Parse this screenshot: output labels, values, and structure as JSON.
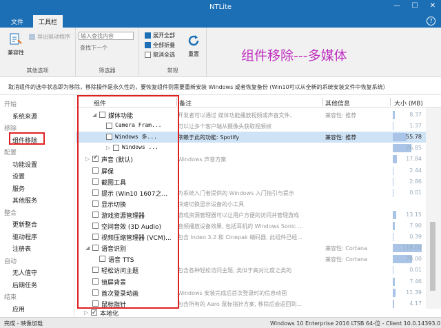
{
  "window": {
    "title": "NTLite"
  },
  "tabs": [
    "文件",
    "工具栏"
  ],
  "ribbon": {
    "compat_label": "兼容性",
    "export_driver_label": "导出驱动程序",
    "other_options_label": "其他选项",
    "search_placeholder": "输入查找内容",
    "find_next_label": "查找下一个",
    "filter_label": "筛选器",
    "expand_all_label": "展开全部",
    "collapse_all_label": "全部折叠",
    "uncheck_all_label": "取消全选",
    "general_label": "常规",
    "reset_label": "重置"
  },
  "overlay_title": "组件移除---多媒体",
  "info_text": "取消组件的选中状态即为移除，移除操作是永久性的，要恢复组件则需要重新安装 Windows 或者恢复备份 (Win10可以从全新的系统安装文件中恢复系统）",
  "sidebar": [
    {
      "kind": "head",
      "label": "开始"
    },
    {
      "kind": "item",
      "label": "系统来源"
    },
    {
      "kind": "head",
      "label": "移除"
    },
    {
      "kind": "item",
      "label": "组件移除"
    },
    {
      "kind": "head",
      "label": "配置"
    },
    {
      "kind": "item",
      "label": "功能设置"
    },
    {
      "kind": "item",
      "label": "设置"
    },
    {
      "kind": "item",
      "label": "服务"
    },
    {
      "kind": "item",
      "label": "其他服务"
    },
    {
      "kind": "head",
      "label": "整合"
    },
    {
      "kind": "item",
      "label": "更新整合"
    },
    {
      "kind": "item",
      "label": "驱动程序"
    },
    {
      "kind": "item",
      "label": "注册表"
    },
    {
      "kind": "head",
      "label": "自动"
    },
    {
      "kind": "item",
      "label": "无人值守"
    },
    {
      "kind": "item",
      "label": "后期任务"
    },
    {
      "kind": "head",
      "label": "结束"
    },
    {
      "kind": "item",
      "label": "应用"
    }
  ],
  "columns": {
    "component": "组件",
    "note": "备注",
    "other": "其他信息",
    "size": "大小 (MB)"
  },
  "rows": [
    {
      "indent": 2,
      "twisty": "expanded",
      "checked": false,
      "name": "媒体功能",
      "note": "开发者可以通过 媒体功能播放视频或声音文件、",
      "other": "兼容性: 推荐",
      "size": "8.37",
      "bar": 0.07
    },
    {
      "indent": 3,
      "twisty": "none",
      "checked": false,
      "name": "Camera Fram...",
      "mono": true,
      "note": "可以让多个客户端从摄像头获取视频帧",
      "other": "",
      "size": "1.37",
      "bar": 0.01
    },
    {
      "indent": 3,
      "twisty": "none",
      "checked": false,
      "name": "Windows 多...",
      "mono": true,
      "note": "依赖于此的功能: Spotify",
      "note_dark": true,
      "other": "兼容性: 推荐",
      "other_dark": true,
      "size": "55.78",
      "size_dark": true,
      "bar": 0.47,
      "highlight": true
    },
    {
      "indent": 4,
      "twisty": "collapsed",
      "checked": false,
      "name": "Windows ...",
      "mono": true,
      "note": "",
      "other": "",
      "size": "76.85",
      "bar": 0.65
    },
    {
      "indent": 1,
      "twisty": "collapsed",
      "checked": true,
      "name": "声音 (默认)",
      "note": "Windows 声音方案",
      "other": "",
      "size": "17.84",
      "bar": 0.15
    },
    {
      "indent": 1,
      "twisty": "none",
      "checked": false,
      "name": "屏保",
      "note": "",
      "other": "",
      "size": "2.44",
      "bar": 0.02
    },
    {
      "indent": 1,
      "twisty": "none",
      "checked": false,
      "name": "截图工具",
      "note": "",
      "other": "",
      "size": "2.86",
      "bar": 0.02
    },
    {
      "indent": 1,
      "twisty": "none",
      "checked": false,
      "name": "提示 (Win10 1607之...",
      "note": "为系统入门者提供的 Windows 入门指引与提示",
      "other": "",
      "size": "0.01",
      "bar": 0.0
    },
    {
      "indent": 1,
      "twisty": "none",
      "checked": false,
      "name": "显示切换",
      "note": "快速切换显示设备的小工具",
      "other": "",
      "size": "",
      "bar": 0.0
    },
    {
      "indent": 1,
      "twisty": "none",
      "checked": false,
      "name": "游戏资源管理器",
      "note": "游戏资源管理器可以让用户方便的访问并管理游戏",
      "other": "",
      "size": "13.15",
      "bar": 0.11
    },
    {
      "indent": 1,
      "twisty": "none",
      "checked": false,
      "name": "空间音效 (3D Audio)",
      "note": "音频播放设备效果, 包括耳机的 Windows Sonic ...",
      "other": "",
      "size": "7.90",
      "bar": 0.07
    },
    {
      "indent": 1,
      "twisty": "none",
      "checked": false,
      "name": "视频压缩管理器 (VCM)...",
      "note": "包含 Indeo 3.2 和 Cinepak 编码器, 此组件已经...",
      "other": "",
      "size": "0.39",
      "bar": 0.0
    },
    {
      "indent": 1,
      "twisty": "expanded",
      "checked": false,
      "name": "语音识别",
      "note": "",
      "other": "兼容性: Cortana",
      "size": "118.00",
      "bar": 1.0
    },
    {
      "indent": 2,
      "twisty": "none",
      "checked": false,
      "name": "语音 TTS",
      "note": "",
      "other": "兼容性: Cortana",
      "size": "78.00",
      "bar": 0.66
    },
    {
      "indent": 1,
      "twisty": "none",
      "checked": false,
      "name": "轻松访问主题",
      "note": "包含各种轻松访问主题, 类似于高对比度之类的",
      "other": "",
      "size": "0.01",
      "bar": 0.0
    },
    {
      "indent": 1,
      "twisty": "none",
      "checked": false,
      "name": "锁屏背景",
      "note": "",
      "other": "",
      "size": "7.46",
      "bar": 0.06
    },
    {
      "indent": 1,
      "twisty": "none",
      "checked": false,
      "name": "首次登录动画",
      "note": "Windows 安装完成后首次登录时的信息动画",
      "other": "",
      "size": "11.39",
      "bar": 0.1
    },
    {
      "indent": 1,
      "twisty": "none",
      "checked": false,
      "name": "鼠标指针",
      "note": "包含所有的 Aero 鼠标指针方案, 移除后会返回到...",
      "other": "",
      "size": "4.17",
      "bar": 0.04
    }
  ],
  "footer_item": {
    "label": "本地化",
    "checked": true
  },
  "status": {
    "left": "完成 - 映像加载",
    "right": "Windows 10 Enterprise 2016 LTSB 64-位 - Client 10.0.14393.0"
  },
  "colors": {
    "titlebar": "#1c6fb5",
    "overlay": "#c030c0",
    "highlight": "#e02020"
  }
}
